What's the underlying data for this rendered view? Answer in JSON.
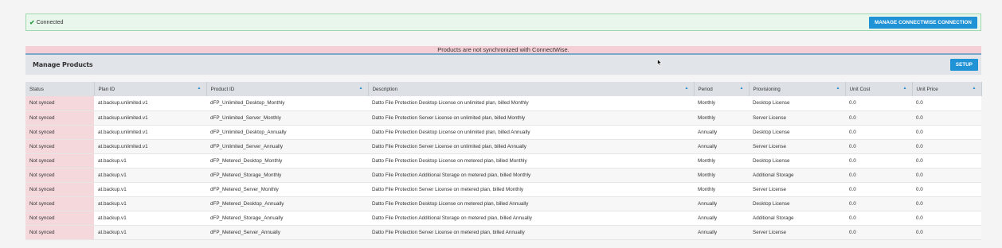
{
  "connection": {
    "status_icon": "check-icon",
    "status_text": "Connected",
    "manage_button": "MANAGE CONNECTWISE CONNECTION"
  },
  "sync_banner": "Products are not synchronized with ConnectWise.",
  "products": {
    "title": "Manage Products",
    "setup_button": "SETUP"
  },
  "table": {
    "columns": [
      {
        "label": "Status",
        "sortable": false
      },
      {
        "label": "Plan ID",
        "sortable": true
      },
      {
        "label": "Product ID",
        "sortable": true
      },
      {
        "label": "Description",
        "sortable": true
      },
      {
        "label": "Period",
        "sortable": true
      },
      {
        "label": "Provisioning",
        "sortable": true
      },
      {
        "label": "Unit Cost",
        "sortable": true
      },
      {
        "label": "Unit Price",
        "sortable": true
      }
    ],
    "rows": [
      [
        "Not synced",
        "at.backup.unlimited.v1",
        "dFP_Unlimited_Desktop_Monthly",
        "Datto File Protection Desktop License on unlimited plan, billed Monthly",
        "Monthly",
        "Desktop License",
        "0.0",
        "0.0"
      ],
      [
        "Not synced",
        "at.backup.unlimited.v1",
        "dFP_Unlimited_Server_Monthly",
        "Datto File Protection Server License on unlimited plan, billed Monthly",
        "Monthly",
        "Server License",
        "0.0",
        "0.0"
      ],
      [
        "Not synced",
        "at.backup.unlimited.v1",
        "dFP_Unlimited_Desktop_Annually",
        "Datto File Protection Desktop License on unlimited plan, billed Annually",
        "Annually",
        "Desktop License",
        "0.0",
        "0.0"
      ],
      [
        "Not synced",
        "at.backup.unlimited.v1",
        "dFP_Unlimited_Server_Annually",
        "Datto File Protection Server License on unlimited plan, billed Annually",
        "Annually",
        "Server License",
        "0.0",
        "0.0"
      ],
      [
        "Not synced",
        "at.backup.v1",
        "dFP_Metered_Desktop_Monthly",
        "Datto File Protection Desktop License on metered plan, billed Monthly",
        "Monthly",
        "Desktop License",
        "0.0",
        "0.0"
      ],
      [
        "Not synced",
        "at.backup.v1",
        "dFP_Metered_Storage_Monthly",
        "Datto File Protection Additional Storage on metered plan, billed Monthly",
        "Monthly",
        "Additional Storage",
        "0.0",
        "0.0"
      ],
      [
        "Not synced",
        "at.backup.v1",
        "dFP_Metered_Server_Monthly",
        "Datto File Protection Server License on metered plan, billed Monthly",
        "Monthly",
        "Server License",
        "0.0",
        "0.0"
      ],
      [
        "Not synced",
        "at.backup.v1",
        "dFP_Metered_Desktop_Annually",
        "Datto File Protection Desktop License on metered plan, billed Annually",
        "Annually",
        "Desktop License",
        "0.0",
        "0.0"
      ],
      [
        "Not synced",
        "at.backup.v1",
        "dFP_Metered_Storage_Annually",
        "Datto File Protection Additional Storage on metered plan, billed Annually",
        "Annually",
        "Additional Storage",
        "0.0",
        "0.0"
      ],
      [
        "Not synced",
        "at.backup.v1",
        "dFP_Metered_Server_Annually",
        "Datto File Protection Server License on metered plan, billed Annually",
        "Annually",
        "Server License",
        "0.0",
        "0.0"
      ]
    ]
  },
  "colors": {
    "accent": "#1f93d6",
    "connected_bg": "#e8f6ec",
    "warning_bg": "#f4cfd6",
    "not_synced_bg": "#f4d8dc"
  }
}
